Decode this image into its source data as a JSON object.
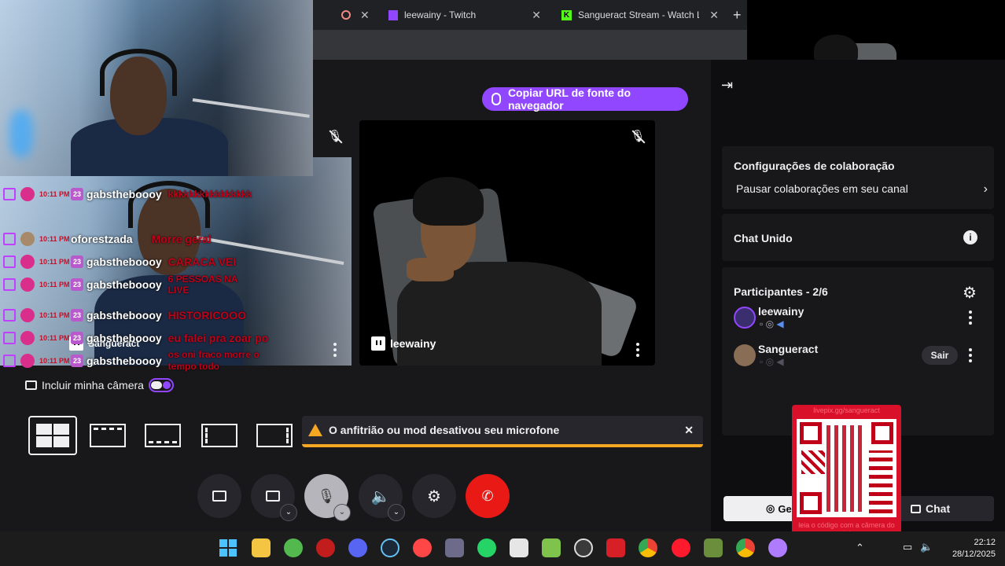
{
  "browser": {
    "tabs": [
      {
        "title": "leewainy - Twitch"
      },
      {
        "title": "Sangueract Stream - Watch Li"
      }
    ]
  },
  "collab": {
    "copy_url_label": "Copiar URL de fonte do navegador",
    "host_label": "Sangueract",
    "guest_label": "leewainy",
    "include_camera_label": "Incluir minha câmera",
    "toast_text": "O anfitrião ou mod desativou seu microfone"
  },
  "chat_overlay": [
    {
      "time": "10:11 PM",
      "user": "gabstheboooy",
      "message": "kkkkkkkkkkkkkkkk"
    },
    {
      "time": "10:11 PM",
      "user": "oforestzada",
      "message": "Morre geral"
    },
    {
      "time": "10:11 PM",
      "user": "gabstheboooy",
      "message": "CARACA VEI"
    },
    {
      "time": "10:11 PM",
      "user": "gabstheboooy",
      "message": "6 PESSOAS NA LIVE"
    },
    {
      "time": "10:11 PM",
      "user": "gabstheboooy",
      "message": "HISTORICOOO"
    },
    {
      "time": "10:11 PM",
      "user": "gabstheboooy",
      "message": "eu falei pra zoar po"
    },
    {
      "time": "10:11 PM",
      "user": "gabstheboooy",
      "message": "os oni fraco morre o tempo todo"
    }
  ],
  "right_panel": {
    "collab_settings_title": "Configurações de colaboração",
    "pause_collab_label": "Pausar colaborações em seu canal",
    "unified_chat_title": "Chat Unido",
    "participants_title": "Participantes - 2/6",
    "participants": [
      {
        "name": "leewainy"
      },
      {
        "name": "Sangueract",
        "action": "Sair"
      }
    ],
    "bottom_tabs": [
      "Ge",
      "Chat"
    ]
  },
  "overlay_qr": {
    "top_text": "livepix.gg/sangueract",
    "bottom_text": "leia o código com a câmera do celular"
  },
  "system_tray": {
    "time": "22:12",
    "date": "28/12/2025"
  },
  "colors": {
    "twitch_purple": "#9147ff",
    "end_call_red": "#e91916",
    "toast_yellow": "#f5a623",
    "chat_red": "#c00018"
  }
}
